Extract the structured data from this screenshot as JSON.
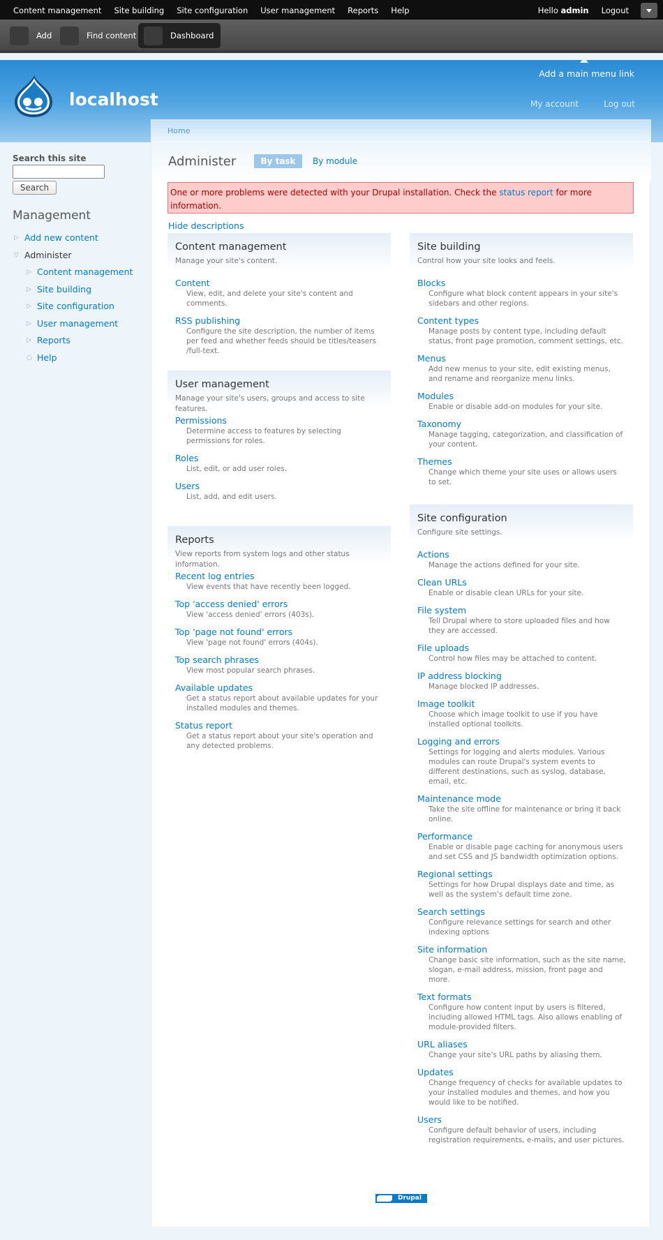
{
  "toolbar": {
    "menu": [
      "Content management",
      "Site building",
      "Site configuration",
      "User management",
      "Reports",
      "Help"
    ],
    "hello_prefix": "Hello",
    "username": "admin",
    "logout": "Logout",
    "shortcuts": [
      "Add",
      "Find content",
      "Dashboard"
    ]
  },
  "header": {
    "site_name": "localhost",
    "main_menu_link": "Add a main menu link",
    "secondary_links": [
      "My account",
      "Log out"
    ]
  },
  "sidebar": {
    "search_label": "Search this site",
    "search_button": "Search",
    "management_title": "Management",
    "nav": [
      {
        "label": "Add new content",
        "level": 0,
        "link": true,
        "expanded": false
      },
      {
        "label": "Administer",
        "level": 0,
        "link": false,
        "expanded": true
      },
      {
        "label": "Content management",
        "level": 1,
        "link": true,
        "expanded": false
      },
      {
        "label": "Site building",
        "level": 1,
        "link": true,
        "expanded": false
      },
      {
        "label": "Site configuration",
        "level": 1,
        "link": true,
        "expanded": false
      },
      {
        "label": "User management",
        "level": 1,
        "link": true,
        "expanded": false
      },
      {
        "label": "Reports",
        "level": 1,
        "link": true,
        "expanded": false
      },
      {
        "label": "Help",
        "level": 1,
        "link": true,
        "leaf": true
      }
    ]
  },
  "main": {
    "breadcrumb": "Home",
    "title": "Administer",
    "tab_task": "By task",
    "tab_module": "By module",
    "error_before": "One or more problems were detected with your Drupal installation. Check the ",
    "error_link": "status report",
    "error_after": " for more information.",
    "hide_descriptions": "Hide descriptions",
    "left_sections": [
      {
        "title": "Content management",
        "desc": "Manage your site's content.",
        "items": [
          {
            "label": "Content",
            "desc": "View, edit, and delete your site's content and comments."
          },
          {
            "label": "RSS publishing",
            "desc": "Configure the site description, the number of items per feed and whether feeds should be titles/teasers /full-text."
          }
        ]
      },
      {
        "title": "User management",
        "desc": "Manage your site's users, groups and access to site features.",
        "items": [
          {
            "label": "Permissions",
            "desc": "Determine access to features by selecting permissions for roles."
          },
          {
            "label": "Roles",
            "desc": "List, edit, or add user roles."
          },
          {
            "label": "Users",
            "desc": "List, add, and edit users."
          }
        ]
      },
      {
        "title": "Reports",
        "desc": "View reports from system logs and other status information.",
        "items": [
          {
            "label": "Recent log entries",
            "desc": "View events that have recently been logged."
          },
          {
            "label": "Top 'access denied' errors",
            "desc": "View 'access denied' errors (403s)."
          },
          {
            "label": "Top 'page not found' errors",
            "desc": "View 'page not found' errors (404s)."
          },
          {
            "label": "Top search phrases",
            "desc": "View most popular search phrases."
          },
          {
            "label": "Available updates",
            "desc": "Get a status report about available updates for your installed modules and themes."
          },
          {
            "label": "Status report",
            "desc": "Get a status report about your site's operation and any detected problems."
          }
        ]
      }
    ],
    "right_sections": [
      {
        "title": "Site building",
        "desc": "Control how your site looks and feels.",
        "items": [
          {
            "label": "Blocks",
            "desc": "Configure what block content appears in your site's sidebars and other regions."
          },
          {
            "label": "Content types",
            "desc": "Manage posts by content type, including default status, front page promotion, comment settings, etc."
          },
          {
            "label": "Menus",
            "desc": "Add new menus to your site, edit existing menus, and rename and reorganize menu links."
          },
          {
            "label": "Modules",
            "desc": "Enable or disable add-on modules for your site."
          },
          {
            "label": "Taxonomy",
            "desc": "Manage tagging, categorization, and classification of your content."
          },
          {
            "label": "Themes",
            "desc": "Change which theme your site uses or allows users to set."
          }
        ]
      },
      {
        "title": "Site configuration",
        "desc": "Configure site settings.",
        "items": [
          {
            "label": "Actions",
            "desc": "Manage the actions defined for your site."
          },
          {
            "label": "Clean URLs",
            "desc": "Enable or disable clean URLs for your site."
          },
          {
            "label": "File system",
            "desc": "Tell Drupal where to store uploaded files and how they are accessed."
          },
          {
            "label": "File uploads",
            "desc": "Control how files may be attached to content."
          },
          {
            "label": "IP address blocking",
            "desc": "Manage blocked IP addresses."
          },
          {
            "label": "Image toolkit",
            "desc": "Choose which image toolkit to use if you have installed optional toolkits."
          },
          {
            "label": "Logging and errors",
            "desc": "Settings for logging and alerts modules. Various modules can route Drupal's system events to different destinations, such as syslog, database, email, etc."
          },
          {
            "label": "Maintenance mode",
            "desc": "Take the site offline for maintenance or bring it back online."
          },
          {
            "label": "Performance",
            "desc": "Enable or disable page caching for anonymous users and set CSS and JS bandwidth optimization options."
          },
          {
            "label": "Regional settings",
            "desc": "Settings for how Drupal displays date and time, as well as the system's default time zone."
          },
          {
            "label": "Search settings",
            "desc": "Configure relevance settings for search and other indexing options"
          },
          {
            "label": "Site information",
            "desc": "Change basic site information, such as the site name, slogan, e-mail address, mission, front page and more."
          },
          {
            "label": "Text formats",
            "desc": "Configure how content input by users is filtered, including allowed HTML tags. Also allows enabling of module-provided filters."
          },
          {
            "label": "URL aliases",
            "desc": "Change your site's URL paths by aliasing them."
          },
          {
            "label": "Updates",
            "desc": "Change frequency of checks for available updates to your installed modules and themes, and how you would like to be notified."
          },
          {
            "label": "Users",
            "desc": "Configure default behavior of users, including registration requirements, e-mails, and user pictures."
          }
        ]
      }
    ],
    "footer_badge": "Drupal"
  },
  "colors": {
    "link": "#027ac6",
    "header_blue": "#2a8bd3",
    "error_bg": "#ffcccc"
  },
  "icons": [
    "drupal-logo-icon",
    "collapsed-triangle-icon",
    "expanded-triangle-icon",
    "bullet-circle-icon",
    "chevron-down-icon"
  ]
}
